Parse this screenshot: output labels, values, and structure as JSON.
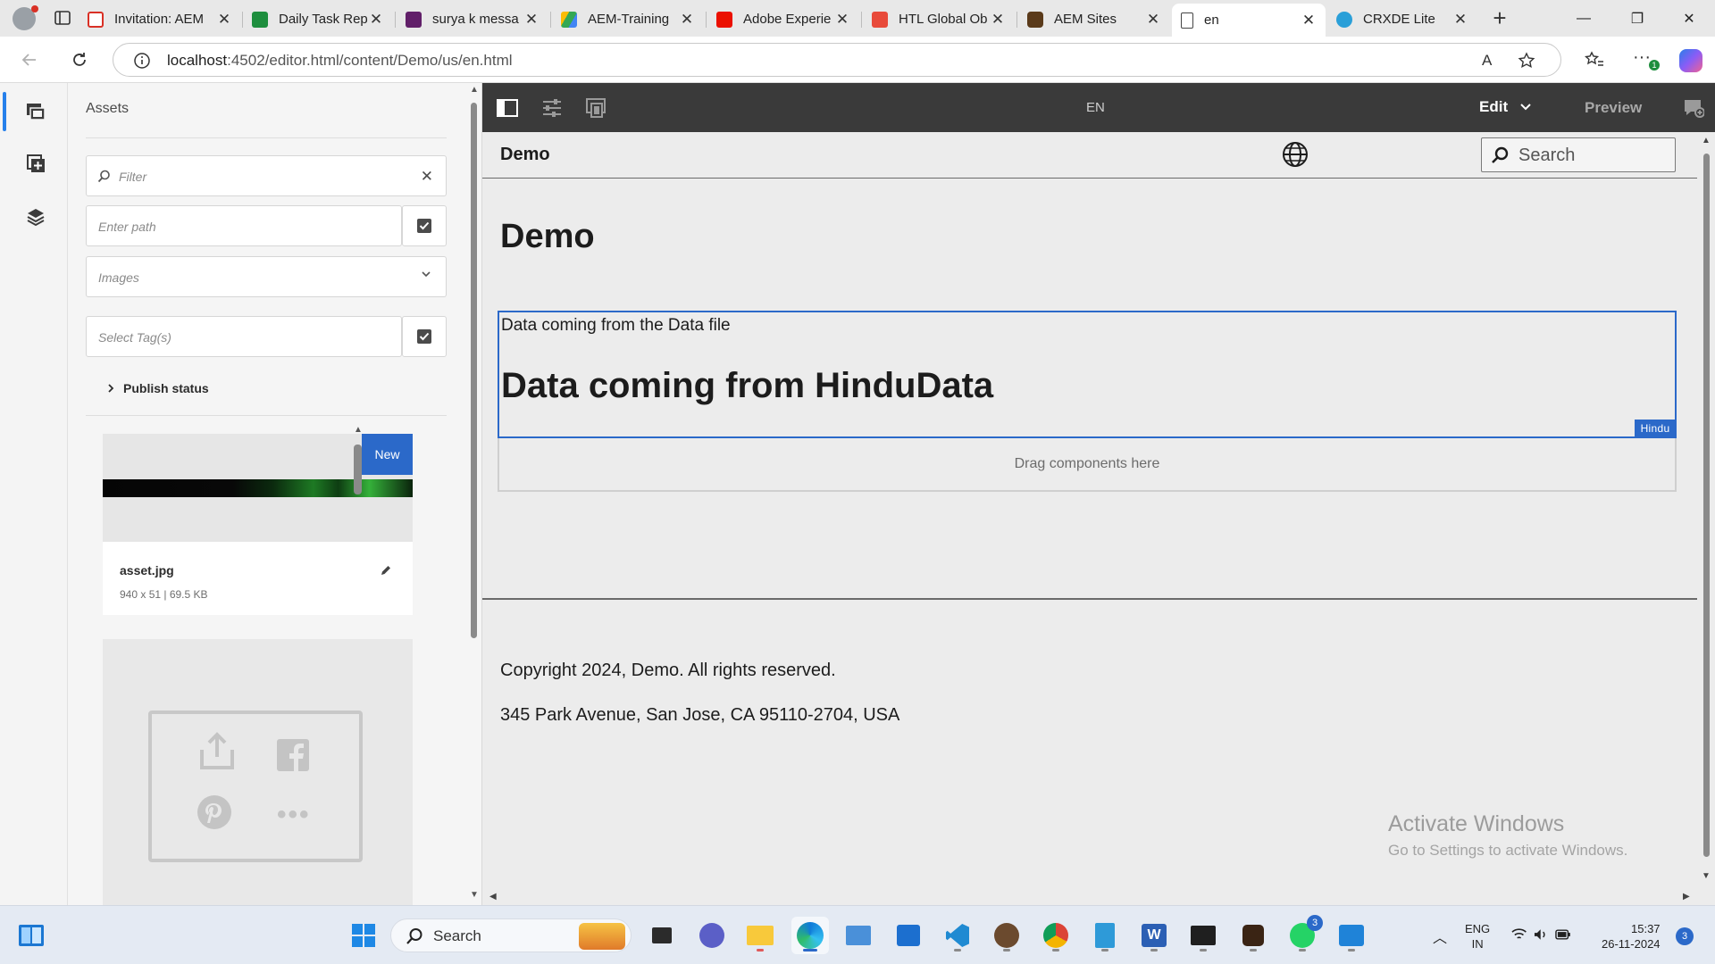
{
  "browser": {
    "tabs": [
      {
        "title": "Invitation: AEM",
        "icon": "gmail-icon",
        "color": "#d93025"
      },
      {
        "title": "Daily Task Rep",
        "icon": "sheets-icon",
        "color": "#1e8e3e"
      },
      {
        "title": "surya k messa",
        "icon": "slack-icon",
        "color": "#611f69"
      },
      {
        "title": "AEM-Training",
        "icon": "drive-icon",
        "color": "#34a853"
      },
      {
        "title": "Adobe Experie",
        "icon": "adobe-icon",
        "color": "#eb1000"
      },
      {
        "title": "HTL Global Ob",
        "icon": "adobe-icon",
        "color": "#e84a3a"
      },
      {
        "title": "AEM Sites",
        "icon": "aem-icon",
        "color": "#5a3a1a"
      },
      {
        "title": "en",
        "icon": "page-icon",
        "color": "#444444",
        "active": true
      },
      {
        "title": "CRXDE Lite",
        "icon": "crxde-icon",
        "color": "#2a9fd8"
      }
    ],
    "url_host": "localhost",
    "url_rest": ":4502/editor.html/content/Demo/us/en.html"
  },
  "assets_panel": {
    "title": "Assets",
    "filter_placeholder": "Filter",
    "path_placeholder": "Enter path",
    "type_selected": "Images",
    "tags_placeholder": "Select Tag(s)",
    "publish_status_label": "Publish status",
    "asset": {
      "badge": "New",
      "name": "asset.jpg",
      "meta": "940 x 51 | 69.5 KB"
    }
  },
  "editor_toolbar": {
    "language": "EN",
    "mode": "Edit",
    "preview": "Preview"
  },
  "page": {
    "site_name": "Demo",
    "search_placeholder": "Search",
    "title": "Demo",
    "data_text": "Data coming from the Data file",
    "hindu_heading": "Data coming from HinduData",
    "component_tag": "Hindu",
    "drop_zone": "Drag components here",
    "copyright": "Copyright 2024, Demo. All rights reserved.",
    "address": "345 Park Avenue, San Jose, CA 95110-2704, USA"
  },
  "watermark": {
    "title": "Activate Windows",
    "subtitle": "Go to Settings to activate Windows."
  },
  "taskbar": {
    "search_label": "Search",
    "lang_top": "ENG",
    "lang_bottom": "IN",
    "time": "15:37",
    "date": "26-11-2024",
    "whatsapp_badge": "3",
    "notification_count": "3"
  },
  "colors": {
    "accent": "#2b69c9",
    "toolbar_bg": "#3a3a3a"
  }
}
